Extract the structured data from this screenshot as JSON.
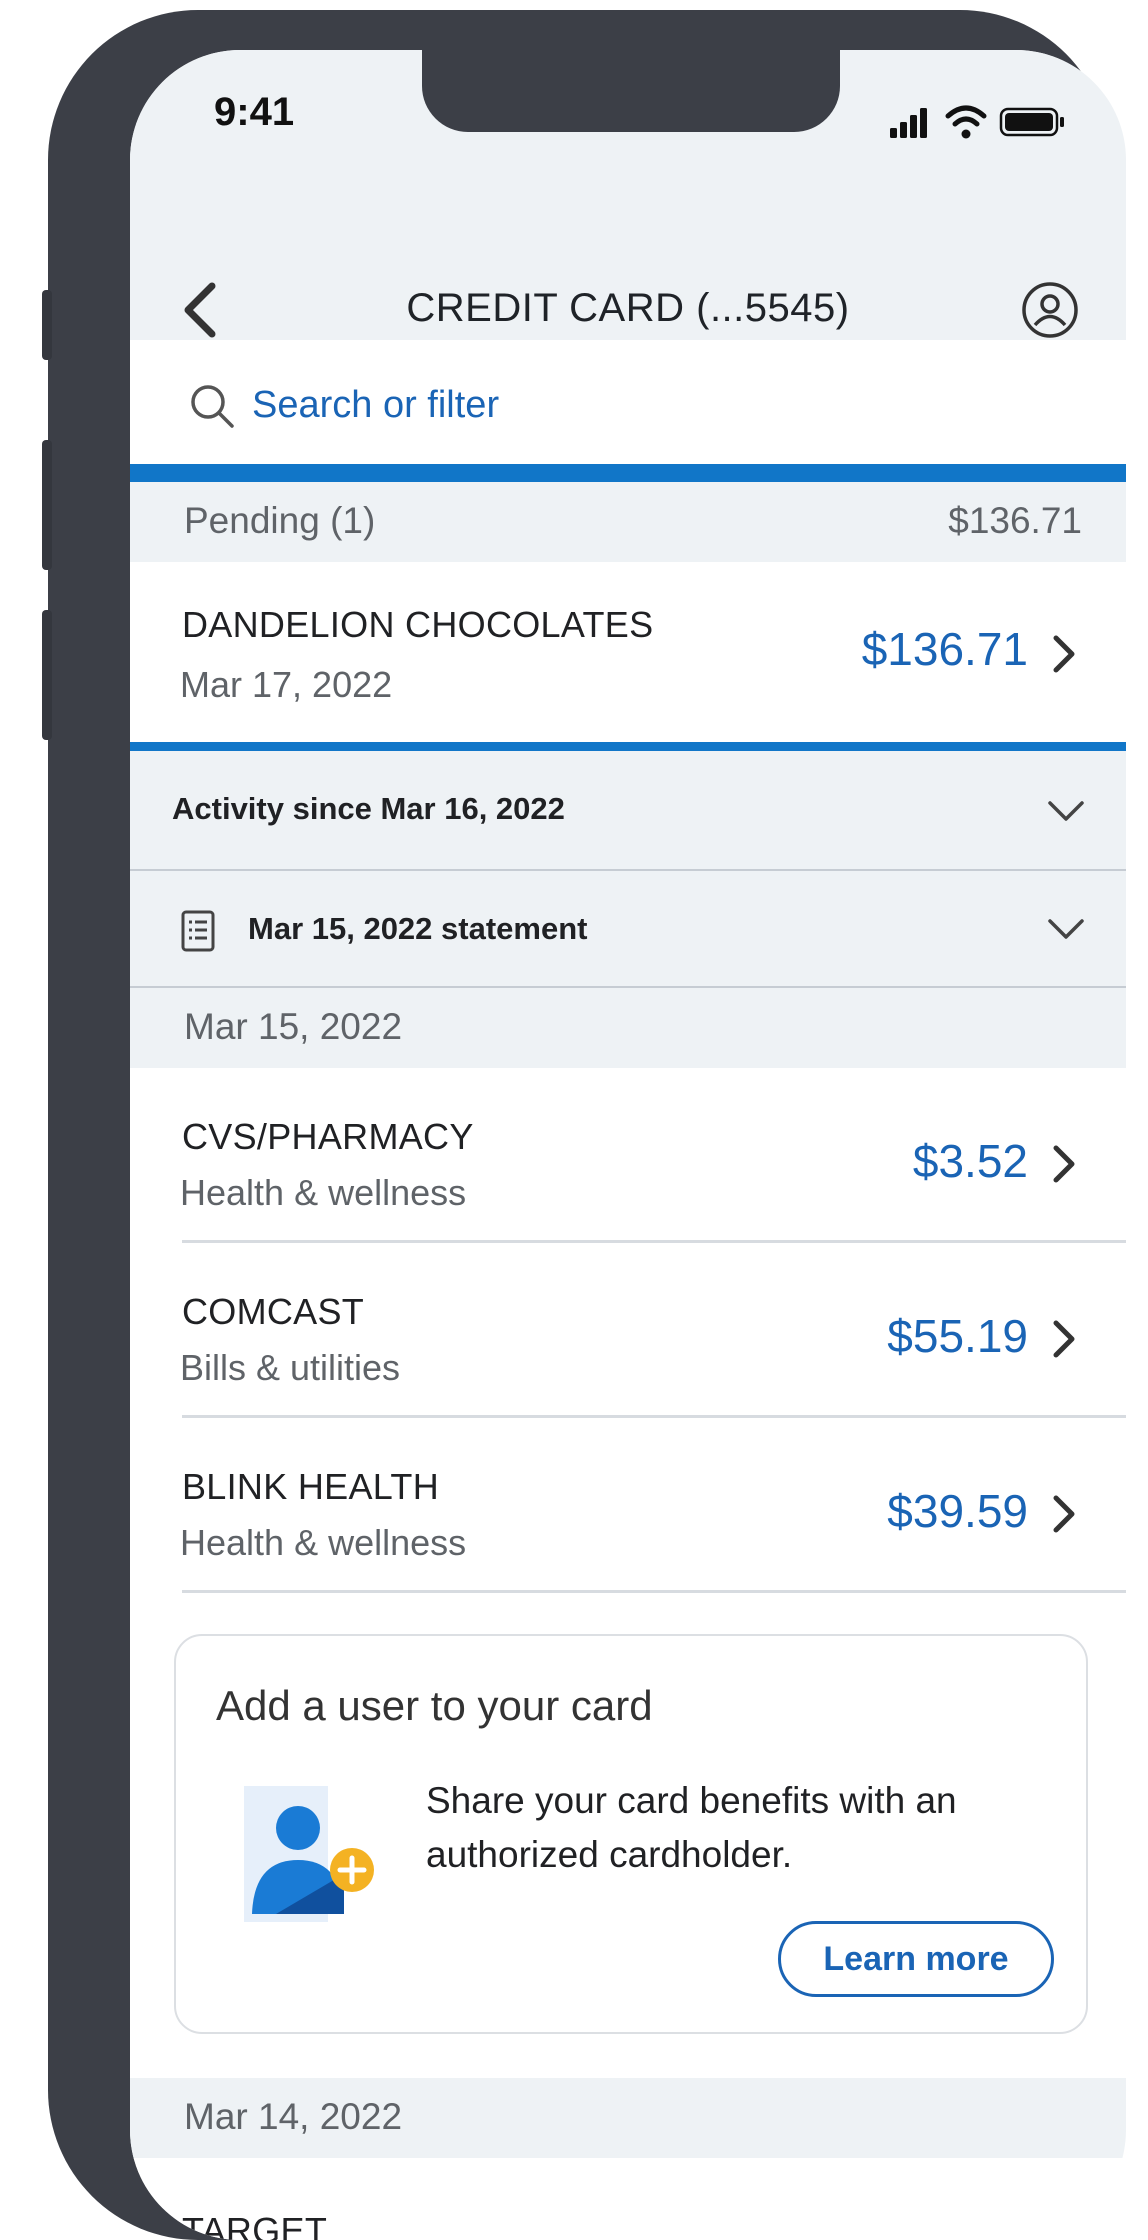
{
  "status_bar": {
    "time": "9:41"
  },
  "header": {
    "title": "CREDIT CARD (...5545)"
  },
  "search": {
    "placeholder": "Search or filter"
  },
  "pending": {
    "label": "Pending (1)",
    "total": "$136.71",
    "transaction": {
      "merchant": "DANDELION CHOCOLATES",
      "date": "Mar 17, 2022",
      "amount": "$136.71"
    }
  },
  "activity_toggle": {
    "label": "Activity since Mar 16, 2022"
  },
  "statement_toggle": {
    "label": "Mar 15, 2022 statement"
  },
  "groups": [
    {
      "date": "Mar 15, 2022",
      "transactions": [
        {
          "merchant": "CVS/PHARMACY",
          "category": "Health & wellness",
          "amount": "$3.52"
        },
        {
          "merchant": "COMCAST",
          "category": "Bills & utilities",
          "amount": "$55.19"
        },
        {
          "merchant": "BLINK HEALTH",
          "category": "Health & wellness",
          "amount": "$39.59"
        }
      ]
    },
    {
      "date": "Mar 14, 2022",
      "transactions": [
        {
          "merchant": "TARGET"
        }
      ]
    }
  ],
  "promo": {
    "title": "Add a user to your card",
    "body": "Share your card benefits with an authorized cardholder.",
    "button_label": "Learn more"
  },
  "colors": {
    "accent": "#1176c8",
    "link": "#1a64b5",
    "section_bg": "#eef2f5",
    "frame": "#3c3f47"
  }
}
